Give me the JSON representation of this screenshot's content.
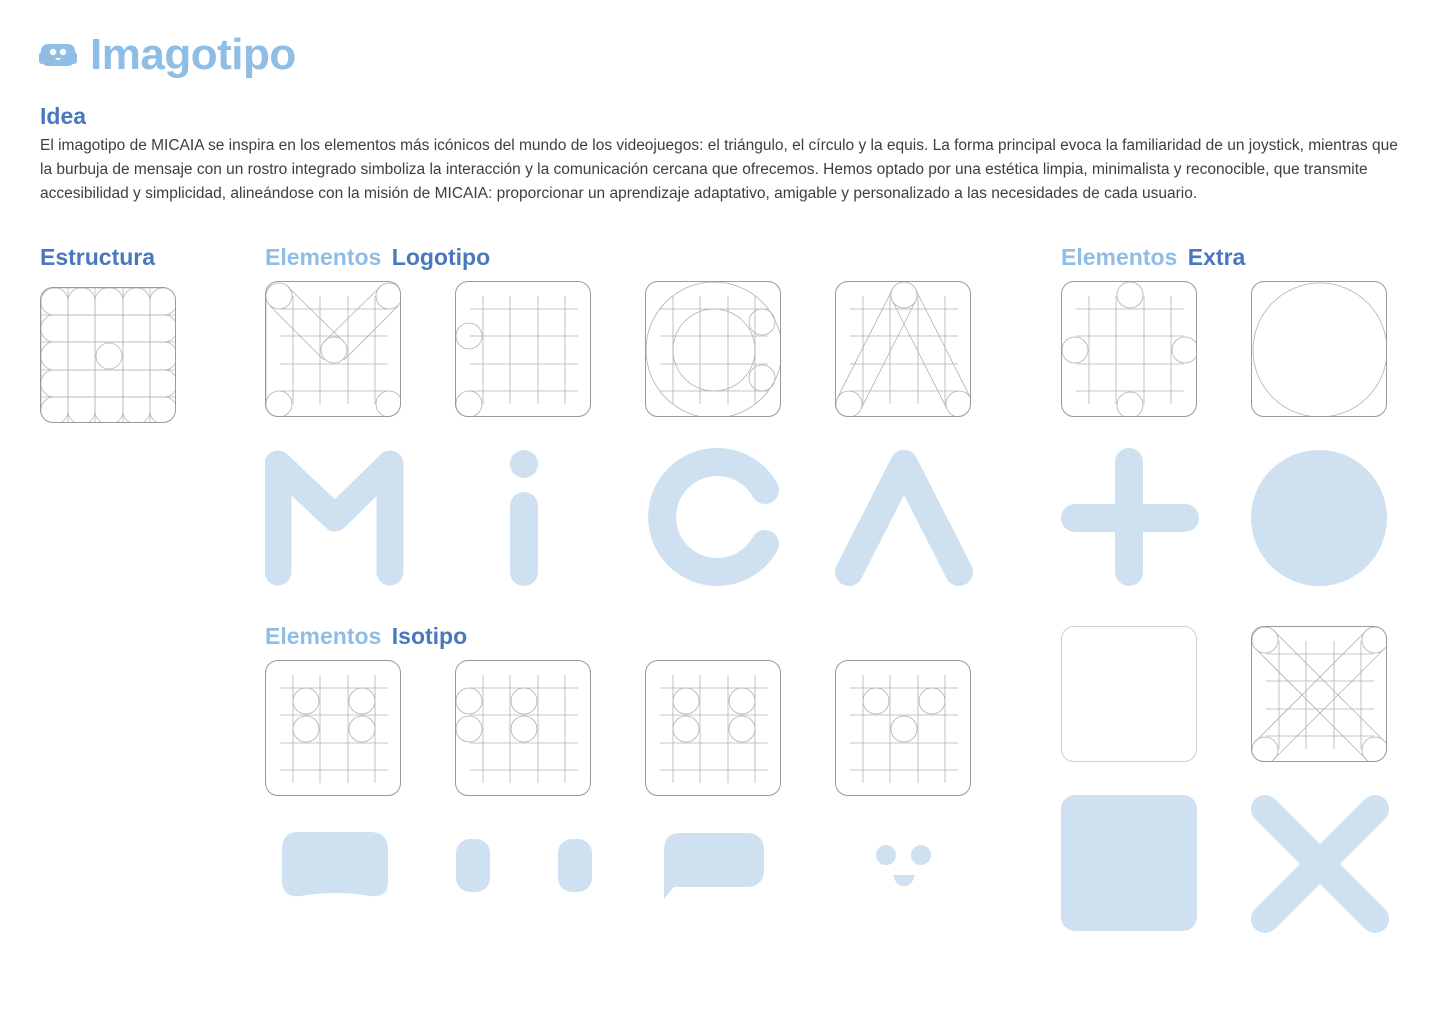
{
  "page": {
    "title": "Imagotipo",
    "icon": "micaia-face-icon",
    "accent_dark": "#4a78bd",
    "accent_light": "#8fbde6",
    "shape_fill": "#cfe0f1"
  },
  "idea": {
    "heading": "Idea",
    "text": "El imagotipo de MICAIA se inspira en los elementos más icónicos del mundo de los videojuegos: el triángulo, el círculo y la equis. La forma principal evoca la familiaridad de un joystick, mientras que la burbuja de mensaje con un rostro integrado simboliza la interacción y la comunicación cercana que ofrecemos. Hemos optado por una estética limpia, minimalista y reconocible, que transmite accesibilidad y simplicidad, alineándose con la misión de MICAIA: proporcionar un aprendizaje adaptativo, amigable y personalizado a las necesidades de cada usuario."
  },
  "sections": {
    "estructura": "Estructura",
    "logotipo": {
      "prefix": "Elementos",
      "name": "Logotipo"
    },
    "isotipo": {
      "prefix": "Elementos",
      "name": "Isotipo"
    },
    "extra": {
      "prefix": "Elementos",
      "name": "Extra"
    }
  },
  "glyphs": {
    "logotipo": [
      "M",
      "i",
      "C",
      "A"
    ],
    "extra": [
      "plus",
      "circle",
      "square",
      "x"
    ],
    "isotipo": [
      "bubble-body",
      "eyes",
      "speech-bubble",
      "face"
    ]
  }
}
